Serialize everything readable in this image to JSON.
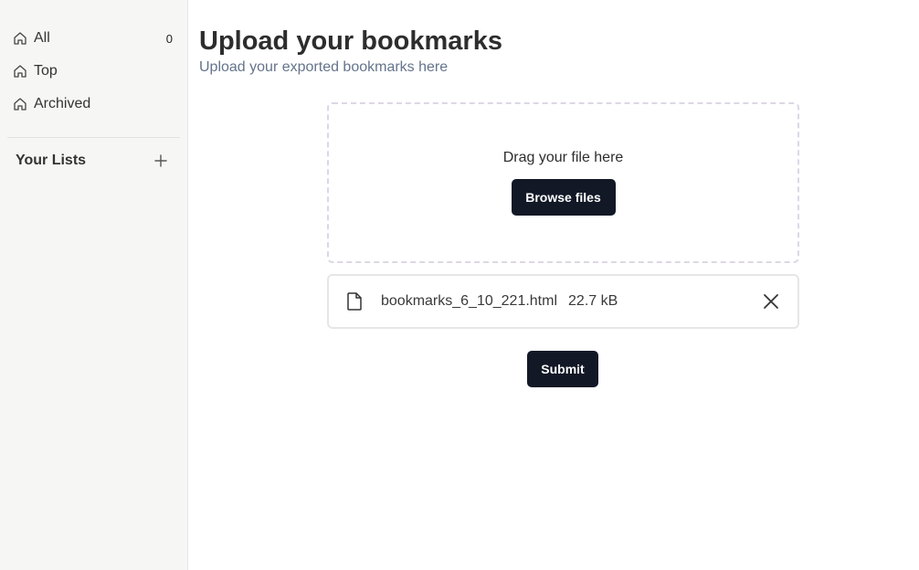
{
  "sidebar": {
    "nav": [
      {
        "label": "All",
        "count": "0",
        "icon": "home-icon"
      },
      {
        "label": "Top",
        "icon": "home-icon"
      },
      {
        "label": "Archived",
        "icon": "home-icon"
      }
    ],
    "lists_title": "Your Lists",
    "add_list_icon": "plus-icon"
  },
  "main": {
    "title": "Upload your bookmarks",
    "subtitle": "Upload your exported bookmarks here",
    "dropzone": {
      "text": "Drag your file here",
      "browse_label": "Browse files"
    },
    "file": {
      "name": "bookmarks_6_10_221.html",
      "size": "22.7 kB",
      "icon": "file-icon",
      "remove_icon": "close-icon"
    },
    "submit_label": "Submit"
  },
  "colors": {
    "sidebar_bg": "#f6f6f4",
    "button_bg": "#121826",
    "subtitle": "#64748b"
  }
}
